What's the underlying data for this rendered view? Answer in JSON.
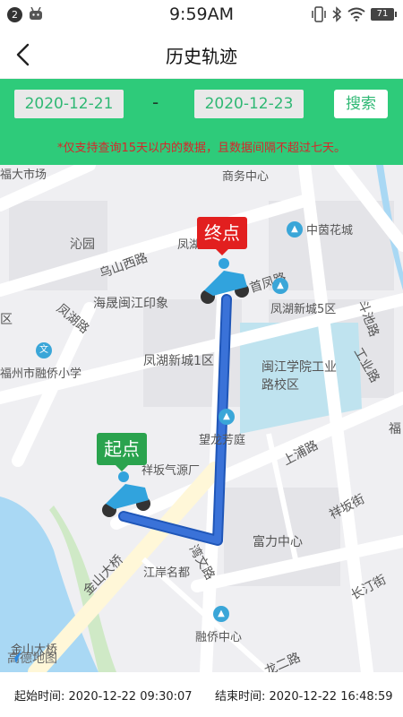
{
  "status_bar": {
    "badge": "2",
    "time": "9:59AM",
    "battery": "71"
  },
  "header": {
    "title": "历史轨迹"
  },
  "filter": {
    "start_date": "2020-12-21",
    "separator": "-",
    "end_date": "2020-12-23",
    "search_label": "搜索",
    "notice": "*仅支持查询15天以内的数据，且数据间隔不超过七天。"
  },
  "map": {
    "labels": {
      "market": "福大市场",
      "business_center": "商务中心",
      "zhongyin": "中茵花城",
      "qinyuan": "沁园",
      "fenghu_top": "凤湖",
      "wushan_road": "乌山西路",
      "shoufeng_road": "首凤路",
      "haisheng": "海晟闽江印象",
      "fenghu5": "凤湖新城5区",
      "qu_left": "区",
      "fenghu_road": "凤湖路",
      "doupi_road": "斗池路",
      "gongye_road": "工业路",
      "qiaoxiao": "福州市融侨小学",
      "fenghu1": "凤湖新城1区",
      "minjiang": "闽江学院工业路校区",
      "fu_right": "福",
      "wanglong": "望龙芳庭",
      "shangpu_road": "上浦路",
      "xiangban": "祥坂气源厂",
      "xiangban_street": "祥坂街",
      "fuli": "富力中心",
      "jinshan_bridge": "金山大桥",
      "jiangan": "江岸名都",
      "wanwen_road": "湾文路",
      "changting_street": "长汀街",
      "qiaoqiao": "融侨中心",
      "er_road": "龙二路",
      "amap": "高德地图",
      "bridge_bottom": "金山大桥"
    },
    "end_marker": "终点",
    "start_marker": "起点"
  },
  "footer": {
    "start_time": "起始时间: 2020-12-22 09:30:07",
    "end_time": "结束时间: 2020-12-22 16:48:59"
  },
  "colors": {
    "accent": "#2ecb7a",
    "route": "#3a72d8",
    "end_marker": "#e21f1f",
    "start_marker": "#2aa34e",
    "water": "#a9d8f4"
  }
}
